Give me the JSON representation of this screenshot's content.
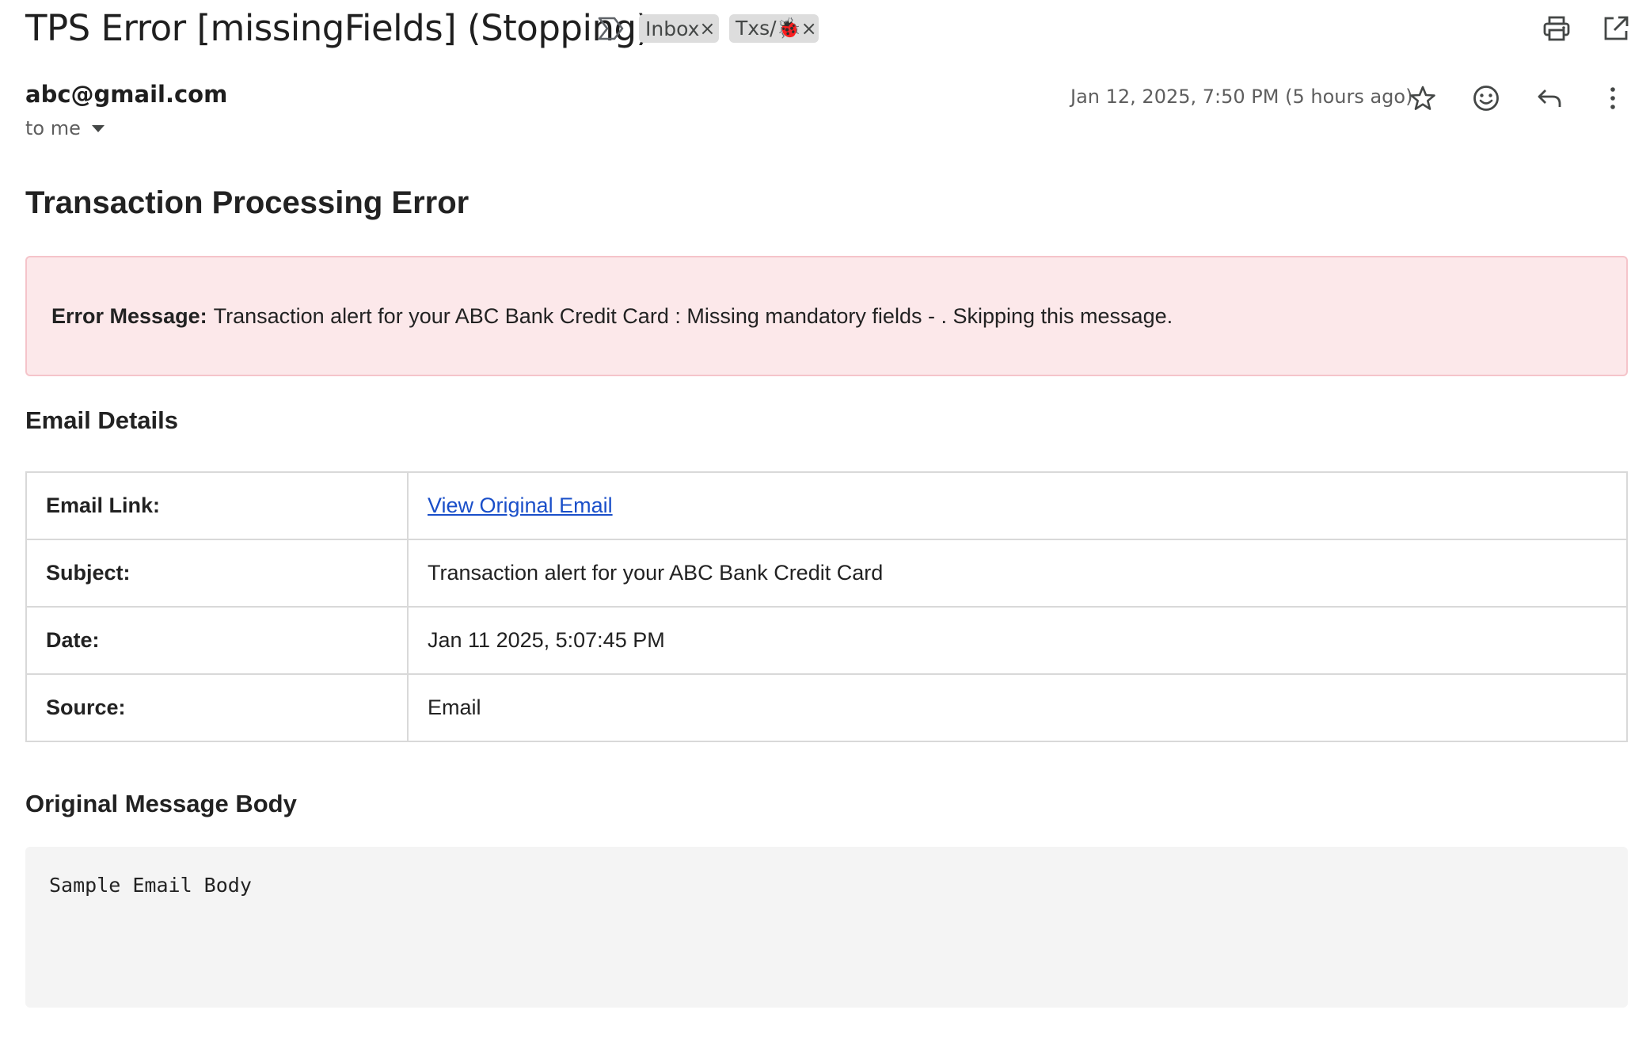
{
  "subject": {
    "title": "TPS Error [missingFields] (Stopping)",
    "labels": [
      {
        "text": "Inbox",
        "remove": "×"
      },
      {
        "text": "Txs/🐞",
        "remove": "×"
      }
    ]
  },
  "icons": {
    "importance": "importance-marker-icon",
    "print": "print-icon",
    "popout": "open-in-new-window-icon",
    "star": "star-icon",
    "emoji": "emoji-reaction-icon",
    "reply": "reply-icon",
    "more": "more-vertical-icon"
  },
  "message": {
    "sender": "abc@gmail.com",
    "recipient": "to me",
    "timestamp": "Jan 12, 2025, 7:50 PM (5 hours ago)"
  },
  "body": {
    "heading": "Transaction Processing Error",
    "error_label": "Error Message:",
    "error_text": "Transaction alert for your ABC Bank Credit Card : Missing mandatory fields - . Skipping this message.",
    "details_heading": "Email Details",
    "details": [
      {
        "key": "Email Link:",
        "value": "View Original Email"
      },
      {
        "key": "Subject:",
        "value": "Transaction alert for your ABC Bank Credit Card"
      },
      {
        "key": "Date:",
        "value": "Jan 11 2025, 5:07:45 PM"
      },
      {
        "key": "Source:",
        "value": "Email"
      }
    ],
    "original_heading": "Original Message Body",
    "original_body": "Sample Email Body"
  },
  "colors": {
    "error_bg": "#fce8ea",
    "error_border": "#f5c4ca",
    "link": "#1a4fc9",
    "chip_bg": "#dddddd",
    "code_bg": "#f4f4f4"
  }
}
